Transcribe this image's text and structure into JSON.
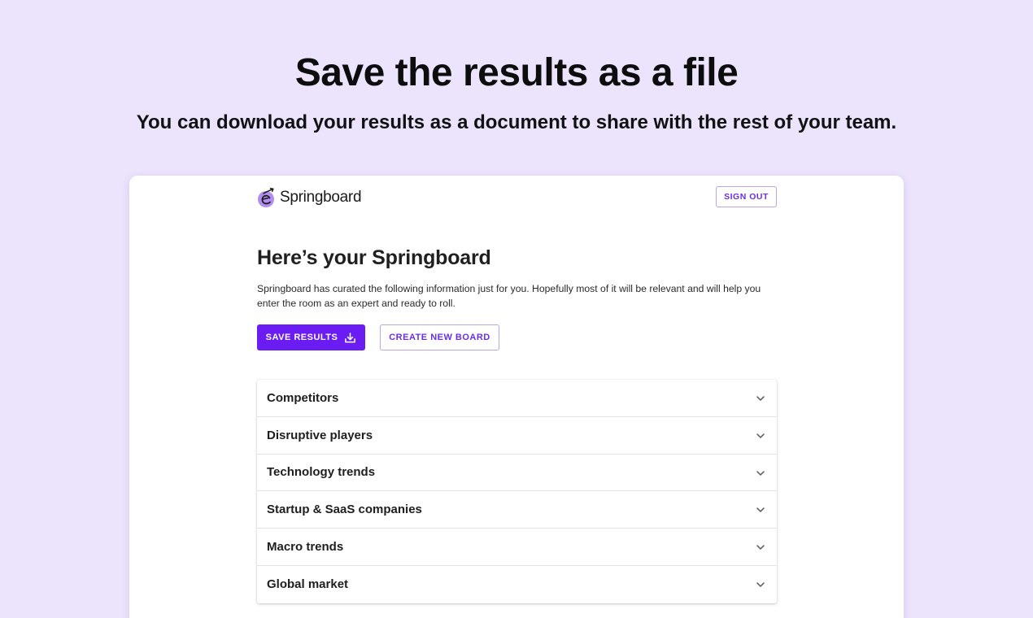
{
  "hero": {
    "title": "Save the results as a file",
    "subtitle": "You can download your results as a document to share with the rest of your team."
  },
  "app": {
    "brand_name": "Springboard",
    "signout_label": "SIGN OUT",
    "page_title": "Here’s your Springboard",
    "intro_line1": "Springboard has curated the following information just for you. Hopefully most of it will be relevant and will help you",
    "intro_line2": "enter the room as an expert and ready to roll.",
    "save_label": "SAVE RESULTS",
    "create_label": "CREATE NEW BOARD",
    "sections": [
      {
        "label": "Competitors"
      },
      {
        "label": "Disruptive players"
      },
      {
        "label": "Technology trends"
      },
      {
        "label": "Startup & SaaS companies"
      },
      {
        "label": "Macro trends"
      },
      {
        "label": "Global market"
      }
    ]
  },
  "colors": {
    "background": "#ece4fc",
    "accent": "#6a1cf2",
    "accent_text": "#6a2ee8",
    "logo": "#b28df0"
  },
  "icons": {
    "brand": "springboard-logo-icon",
    "download": "download-icon",
    "expand": "chevron-down-icon"
  }
}
